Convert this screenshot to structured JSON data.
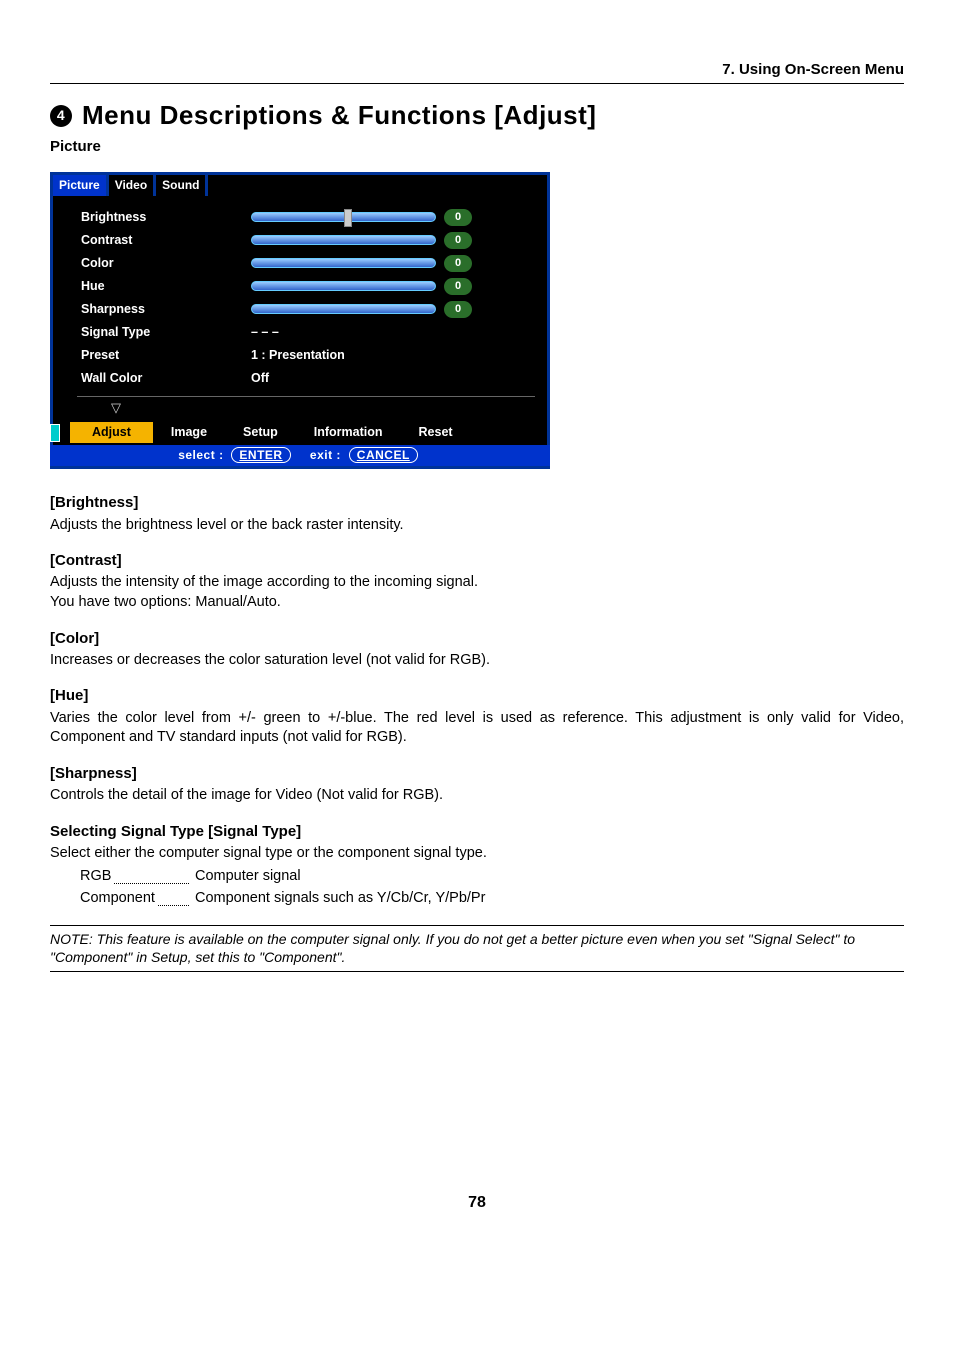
{
  "header": {
    "chapter": "7. Using On-Screen Menu"
  },
  "title": {
    "num": "4",
    "text": "Menu Descriptions & Functions [Adjust]"
  },
  "subheading": "Picture",
  "osd": {
    "tabs": [
      "Picture",
      "Video",
      "Sound"
    ],
    "active_tab": 0,
    "rows": [
      {
        "label": "Brightness",
        "type": "slider-center",
        "value": "0"
      },
      {
        "label": "Contrast",
        "type": "slider-full",
        "value": "0"
      },
      {
        "label": "Color",
        "type": "slider-full",
        "value": "0"
      },
      {
        "label": "Hue",
        "type": "slider-full",
        "value": "0"
      },
      {
        "label": "Sharpness",
        "type": "slider-full",
        "value": "0"
      },
      {
        "label": "Signal Type",
        "type": "text",
        "text": "– – –"
      },
      {
        "label": "Preset",
        "type": "text",
        "text": "1 : Presentation"
      },
      {
        "label": "Wall Color",
        "type": "text",
        "text": "Off"
      }
    ],
    "menubar": [
      "Adjust",
      "Image",
      "Setup",
      "Information",
      "Reset"
    ],
    "menubar_active": 0,
    "hints": {
      "select_label": "select :",
      "select_key": "ENTER",
      "exit_label": "exit :",
      "exit_key": "CANCEL"
    }
  },
  "sections": [
    {
      "h": "[Brightness]",
      "p": [
        "Adjusts the brightness level or the back raster intensity."
      ]
    },
    {
      "h": "[Contrast]",
      "p": [
        "Adjusts the intensity of the image according to the incoming signal.",
        "You have two options: Manual/Auto."
      ]
    },
    {
      "h": "[Color]",
      "p": [
        "Increases or decreases the color saturation level (not valid for RGB)."
      ]
    },
    {
      "h": "[Hue]",
      "p": [
        "Varies the color level from +/- green to +/-blue. The red level is used as reference. This adjustment is only valid for Video, Component and TV standard inputs (not valid for RGB)."
      ]
    },
    {
      "h": "[Sharpness]",
      "p": [
        "Controls the detail of the image for Video (Not valid for RGB)."
      ]
    },
    {
      "h": "Selecting Signal Type [Signal Type]",
      "p": [
        "Select either the computer signal type or the component signal type."
      ],
      "defs": [
        {
          "term": "RGB",
          "desc": "Computer signal"
        },
        {
          "term": "Component",
          "desc": "Component signals such as Y/Cb/Cr, Y/Pb/Pr"
        }
      ]
    }
  ],
  "note": "NOTE: This feature is available on the computer signal only. If you do not get a better picture even when you set \"Signal Select\" to \"Component\" in Setup, set this to \"Component\".",
  "page_number": "78"
}
